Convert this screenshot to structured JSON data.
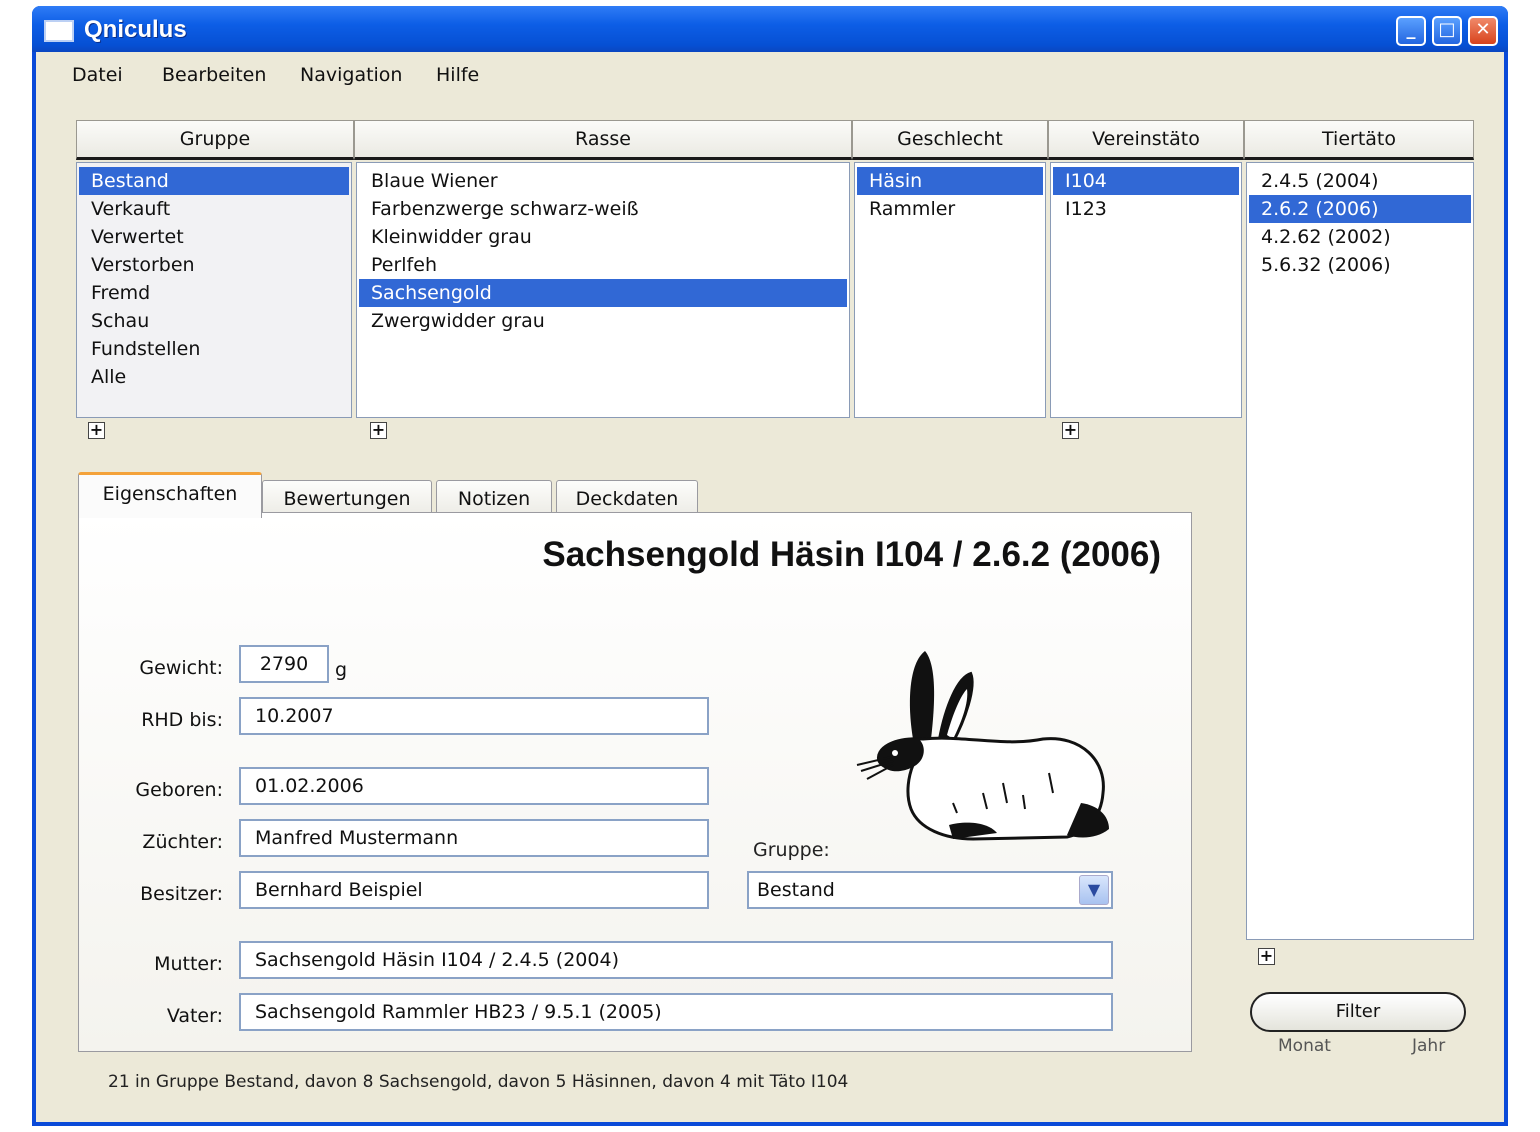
{
  "window": {
    "title": "Qniculus"
  },
  "menu": [
    "Datei",
    "Bearbeiten",
    "Navigation",
    "Hilfe"
  ],
  "lists": {
    "gruppe": {
      "header": "Gruppe",
      "items": [
        "Bestand",
        "Verkauft",
        "Verwertet",
        "Verstorben",
        "Fremd",
        "Schau",
        "Fundstellen",
        "Alle"
      ],
      "selected": "Bestand"
    },
    "rasse": {
      "header": "Rasse",
      "items": [
        "Blaue Wiener",
        "Farbenzwerge schwarz-weiß",
        "Kleinwidder grau",
        "Perlfeh",
        "Sachsengold",
        "Zwergwidder grau"
      ],
      "selected": "Sachsengold"
    },
    "geschlecht": {
      "header": "Geschlecht",
      "items": [
        "Häsin",
        "Rammler"
      ],
      "selected": "Häsin"
    },
    "vereinstaeto": {
      "header": "Vereinstäto",
      "items": [
        "I104",
        "I123"
      ],
      "selected": "I104"
    },
    "tiertaeto": {
      "header": "Tiertäto",
      "items": [
        "2.4.5 (2004)",
        "2.6.2 (2006)",
        "4.2.62 (2002)",
        "5.6.32 (2006)"
      ],
      "selected": "2.6.2 (2006)"
    }
  },
  "tabs": [
    "Eigenschaften",
    "Bewertungen",
    "Notizen",
    "Deckdaten"
  ],
  "active_tab": "Eigenschaften",
  "detail": {
    "title": "Sachsengold Häsin I104 / 2.6.2 (2006)",
    "gewicht_label": "Gewicht:",
    "gewicht": "2790",
    "gewicht_unit": "g",
    "rhd_label": "RHD bis:",
    "rhd": "10.2007",
    "geboren_label": "Geboren:",
    "geboren": "01.02.2006",
    "zuechter_label": "Züchter:",
    "zuechter": "Manfred Mustermann",
    "besitzer_label": "Besitzer:",
    "besitzer": "Bernhard Beispiel",
    "gruppe_label": "Gruppe:",
    "gruppe": "Bestand",
    "mutter_label": "Mutter:",
    "mutter": "Sachsengold Häsin I104 / 2.4.5 (2004)",
    "vater_label": "Vater:",
    "vater": "Sachsengold Rammler HB23 / 9.5.1 (2005)"
  },
  "filter": {
    "button": "Filter",
    "monat": "Monat",
    "jahr": "Jahr"
  },
  "status": "21 in Gruppe Bestand, davon 8 Sachsengold, davon 5 Häsinnen, davon 4 mit Täto I104",
  "colors": {
    "selection": "#3168d5",
    "titlebar": "#0a4ad8",
    "window_bg": "#ece9d8",
    "tab_accent": "#f4a23a"
  }
}
